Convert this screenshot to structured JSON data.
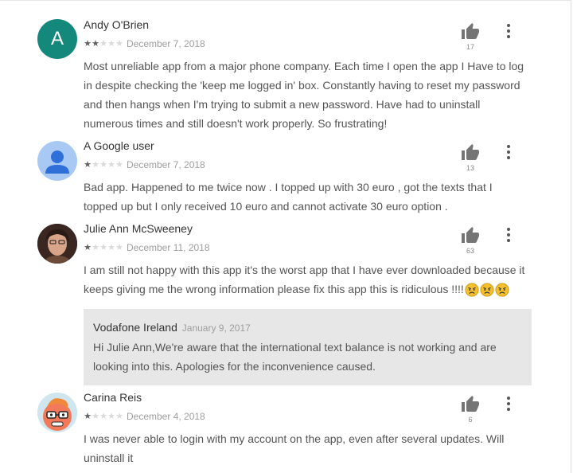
{
  "reviews": [
    {
      "avatar_letter": "A",
      "author": "Andy O'Brien",
      "rating": 2,
      "date": "December 7, 2018",
      "text": "Most unreliable app from a major phone company. Each time I open the app I Have to log in despite checking the 'keep me logged in' box. Constantly having to reset my password and then hangs when I'm trying to submit a new password. Have had to uninstall numerous times and still doesn't work properly. So frustrating!",
      "helpful_count": "17"
    },
    {
      "author": "A Google user",
      "rating": 1,
      "date": "December 7, 2018",
      "text": "Bad app. Happened to me twice now . I topped up with 30 euro , got the texts that I topped up but I only received 10 euro and cannot activate 30 euro option .",
      "helpful_count": "13"
    },
    {
      "author": "Julie Ann McSweeney",
      "rating": 1,
      "date": "December 11, 2018",
      "text": "I am still not happy with this app it's the worst app that I have ever downloaded because it keeps giving me the wrong information please fix this app this is ridiculous !!!!",
      "emojis": [
        "angry-face",
        "angry-face",
        "angry-face"
      ],
      "helpful_count": "63",
      "developer_reply": {
        "name": "Vodafone Ireland",
        "date": "January 9, 2017",
        "text": "Hi Julie Ann,We're aware that the international text balance is not working and are looking into this. Apologies for the inconvenience caused."
      }
    },
    {
      "author": "Carina Reis",
      "rating": 1,
      "date": "December 4, 2018",
      "text": "I was never able to login with my account on the app, even after several updates. Will uninstall it",
      "helpful_count": "6"
    }
  ],
  "icons": {
    "thumb": "thumbs-up-icon",
    "more": "more-vert-icon",
    "star": "star-icon",
    "emoji": "angry-face-icon"
  },
  "colors": {
    "avatar_letter_bg": "#14897b",
    "star_filled": "#616161",
    "star_empty": "#dadada",
    "reply_bg": "#e7e7e7"
  }
}
